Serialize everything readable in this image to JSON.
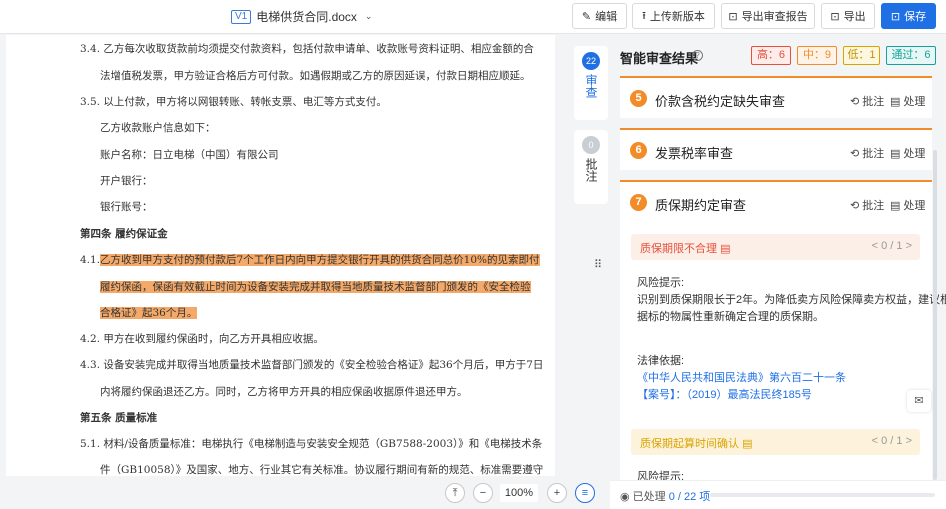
{
  "topbar": {
    "version_tag": "V1",
    "file_name": "电梯供货合同.docx",
    "buttons": {
      "edit": "编辑",
      "upload": "上传新版本",
      "export_report": "导出审查报告",
      "export": "导出",
      "save": "保存"
    }
  },
  "document": {
    "lines": [
      "3.4.  乙方每次收取货款前均须提交付款资料，包括付款申请单、收款账号资料证明、相应金额的合",
      "法增值税发票，甲方验证合格后方可付款。如遇假期或乙方的原因延误，付款日期相应顺延。",
      "3.5.  以上付款，甲方将以网银转账、转帐支票、电汇等方式支付。",
      "乙方收款账户信息如下：",
      "账户名称：日立电梯（中国）有限公司",
      "开户银行：",
      "银行账号：",
      "第四条    履约保证金",
      "4.1.",
      "乙方收到甲方支付的预付款后7个工作日内向甲方提交银行开具的供货合同总价10%的见索即付",
      "履约保函，保函有效截止时间为设备安装完成并取得当地质量技术监督部门颁发的《安全检验",
      "合格证》起36个月。",
      "4.2.  甲方在收到履约保函时，向乙方开具相应收据。",
      "4.3.  设备安装完成并取得当地质量技术监督部门颁发的《安全检验合格证》起36个月后，甲方于7日",
      "内将履约保函退还乙方。同时，乙方将甲方开具的相应保函收据原件退还甲方。",
      "第五条    质量标准",
      "5.1.  材料/设备质量标准：电梯执行《电梯制造与安装安全规范（GB7588-2003）》和《电梯技术条",
      "件（GB10058）》及国家、地方、行业其它有关标准。协议履行期间有新的规范、标准需要遵守"
    ]
  },
  "zoom": {
    "value": "100%"
  },
  "side_tabs": {
    "review_count": "22",
    "review_label": "审查",
    "comment_count": "0",
    "comment_label": "批注"
  },
  "panel": {
    "title": "智能审查结果",
    "chips": {
      "high": "高：6",
      "mid": "中：9",
      "low": "低：1",
      "pass": "通过：6"
    },
    "cards": [
      {
        "num": "5",
        "title": "价款含税约定缺失审查"
      },
      {
        "num": "6",
        "title": "发票税率审查"
      },
      {
        "num": "7",
        "title": "质保期约定审查"
      }
    ],
    "actions": {
      "comment": "批注",
      "handle": "处理"
    },
    "sub1": {
      "label": "质保期限不合理",
      "nav": "< 0 / 1 >"
    },
    "risk_label": "风险提示:",
    "risk_text1": "识别到质保期限长于2年。为降低卖方风险保障卖方权益，建议根",
    "risk_text2": "据标的物属性重新确定合理的质保期。",
    "law_label": "法律依据:",
    "law_link1": "《中华人民共和国民法典》第六百二十一条",
    "law_link2": "【案号】：（2019）最高法民终185号",
    "sub2": {
      "label": "质保期起算时间确认",
      "nav": "< 0 / 1 >"
    },
    "risk_label2": "风险提示:"
  },
  "footer": {
    "processed_label": "已处理",
    "processed_count": "0 / 22 项"
  },
  "colors": {
    "accent": "#1f6fe5",
    "high": "#e8503c",
    "mid": "#f28c28",
    "low": "#d9a400",
    "pass": "#14a39a",
    "highlight": "#f4a968"
  }
}
